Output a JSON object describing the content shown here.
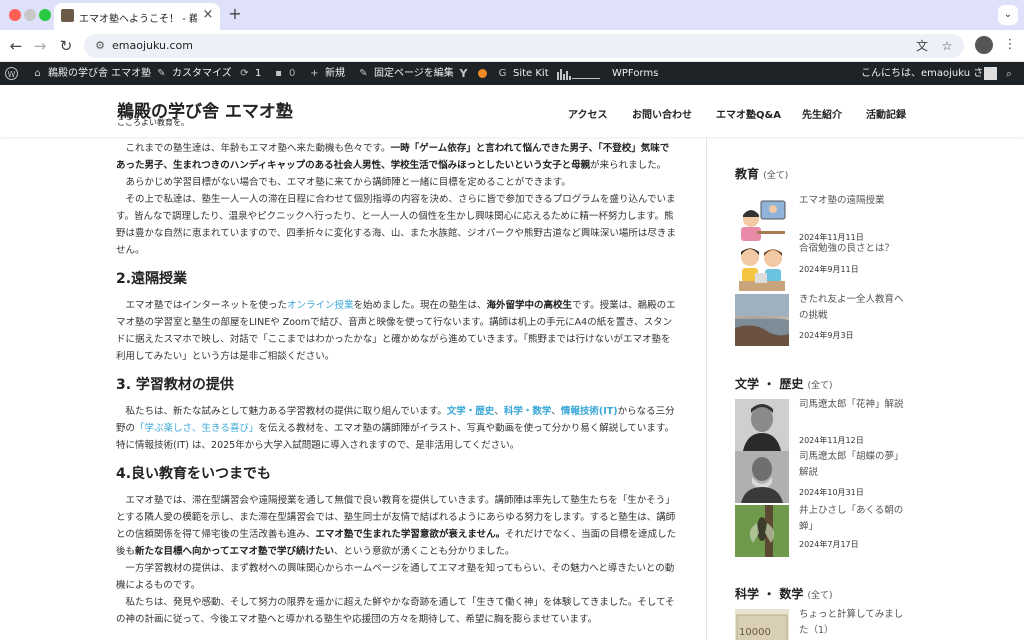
{
  "browser": {
    "tab_title": "エマオ塾へようこそ！ - 鵜殿の学び舎",
    "tab_close": "×",
    "new_tab": "+",
    "url": "emaojuku.com"
  },
  "adminbar": {
    "site_name": "鵜殿の学び舎 エマオ塾",
    "customize": "カスタマイズ",
    "updates_count": "1",
    "comments_count": "0",
    "new": "新規",
    "edit_page": "固定ページを編集",
    "sitekit": "Site Kit",
    "wpforms": "WPForms",
    "greeting": "こんにちは、emaojuku さん"
  },
  "site": {
    "title": "鵜殿の学び舎 エマオ塾",
    "tagline": "こころよい教育を。",
    "nav": [
      "アクセス",
      "お問い合わせ",
      "エマオ塾Q&A",
      "先生紹介",
      "活動記録"
    ]
  },
  "content": {
    "p1_a": "これまでの塾生達は、年齢もエマオ塾へ来た動機も色々です。",
    "p1_b": "一時「ゲーム依存」と言われて悩んできた男子、「不登校」気味であった男子、生まれつきのハンディキャップのある社会人男性、学校生活で悩みほっとしたいという女子と母親",
    "p1_c": "が来られました。",
    "p2": "あらかじめ学習目標がない場合でも、エマオ塾に来てから講師陣と一緒に目標を定めることができます。",
    "p3": "その上で私達は、塾生一人一人の滞在日程に合わせて個別指導の内容を決め、さらに皆で参加できるプログラムを盛り込んでいます。皆んなで調理したり、温泉やピクニックへ行ったり、と一人一人の個性を生かし興味関心に応えるために精一杯努力します。熊野は豊かな自然に恵まれていますので、四季折々に変化する海、山、また水族館、ジオパークや熊野古道など興味深い場所は尽きません。",
    "h2": "2.遠隔授業",
    "p4_a": "エマオ塾ではインターネットを使った",
    "p4_link": "オンライン授業",
    "p4_b": "を始めました。現在の塾生は、",
    "p4_bold": "海外留学中の高校生",
    "p4_c": "です。授業は、鵜殿のエマオ塾の学習室と塾生の部屋をLINEや Zoomで結び、音声と映像を使って行ないます。講師は机上の手元にA4の紙を置き、スタンドに据えたスマホで映し、対話で「ここまではわかったかな」と確かめながら進めていきます。「熊野までは行けないがエマオ塾を利用してみたい」という方は是非ご相談ください。",
    "h3": "3. 学習教材の提供",
    "p5_a": "私たちは、新たな試みとして魅力ある学習教材の提供に取り組んでいます。",
    "p5_l1": "文学・歴史",
    "p5_sep1": "、",
    "p5_l2": "科学・数学",
    "p5_sep2": "、",
    "p5_l3": "情報技術(IT)",
    "p5_b": "からなる三分野の",
    "p5_l4": "「学ぶ楽しさ、生きる喜び」",
    "p5_c": "を伝える教材を、エマオ塾の講師陣がイラスト、写真や動画を使って分かり易く解説しています。特に情報技術(IT) は、2025年から大学入試問題に導入されますので、是非活用してください。",
    "h4": "4.良い教育をいつまでも",
    "p6_a": "エマオ塾では、滞在型講習会や遠隔授業を通して無償で良い教育を提供していきます。講師陣は率先して塾生たちを「生かそう」とする隣人愛の模範を示し、また滞在型講習会では、塾生同士が友情で結ばれるようにあらゆる努力をします。すると塾生は、講師との信頼関係を得て帰宅後の生活改善も進み、",
    "p6_bold": "エマオ塾で生まれた学習意欲が衰えません。",
    "p6_b": "それだけでなく、当面の目標を達成した後も",
    "p6_bold2": "新たな目標へ向かってエマオ塾で学び続けたい",
    "p6_c": "、という意欲が湧くことも分かりました。",
    "p7": "一方学習教材の提供は、まず教材への興味関心からホームページを通してエマオ塾を知ってもらい、その魅力へと導きたいとの動機によるものです。",
    "p8": "私たちは、発見や感動、そして努力の限界を遥かに超えた鮮やかな奇跡を通して「生きて働く神」を体験してきました。そしてその神の計画に従って、今後エマオ塾へと導かれる塾生や応援団の方々を期待して、希望に胸を膨らませています。"
  },
  "sidebar": {
    "all_label": "(全て)",
    "sections": [
      {
        "title": "教育",
        "posts": [
          {
            "title": "エマオ塾の遠隔授業",
            "date": "2024年11月11日"
          },
          {
            "title": "合宿勉強の良さとは？",
            "date": "2024年9月11日"
          },
          {
            "title": "きたれ友よ一全人教育への挑戦",
            "date": "2024年9月3日"
          }
        ]
      },
      {
        "title": "文学 ・ 歴史",
        "posts": [
          {
            "title": "司馬遼太郎「花神」解説",
            "date": "2024年11月12日"
          },
          {
            "title": "司馬遼太郎「胡蝶の夢」解説",
            "date": "2024年10月31日"
          },
          {
            "title": "井上ひさし「あくる朝の蝉」",
            "date": "2024年7月17日"
          }
        ]
      },
      {
        "title": "科学 ・ 数学",
        "posts": [
          {
            "title": "ちょっと計算してみました（1）",
            "date": ""
          }
        ]
      }
    ]
  }
}
